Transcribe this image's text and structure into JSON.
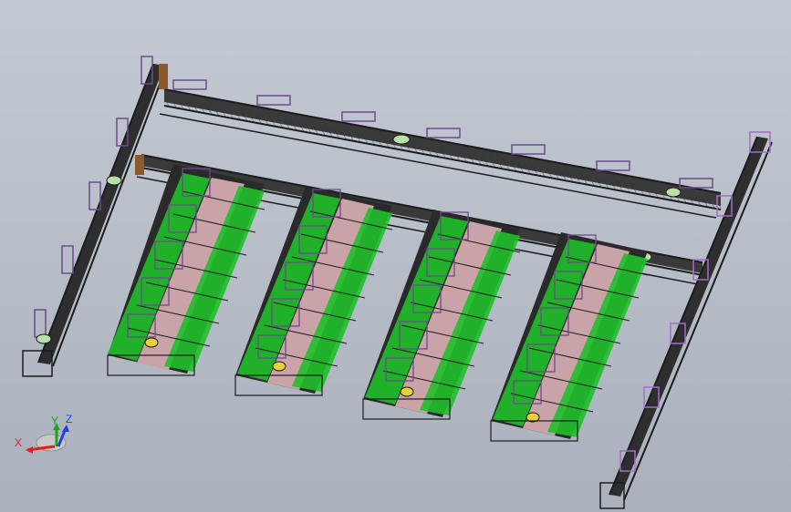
{
  "viewport": {
    "background_top": "#c4cad3",
    "background_bottom": "#aab1bc"
  },
  "colors": {
    "frame": "#1c1c1c",
    "station_green": "#1fbf2a",
    "belt_pink": "#c9a3a8",
    "fixture_purple": "#6d4b8c",
    "fixture_violet": "#a66bc9",
    "part_yellow": "#e8d23a",
    "motor_brown": "#8a5a2a",
    "pad_green": "#b8e0a8"
  },
  "triad": {
    "x_label": "X",
    "y_label": "Y",
    "z_label": "Z",
    "x_color": "#e02020",
    "y_color": "#20a020",
    "z_color": "#2040e0"
  },
  "model": {
    "description_icon": "assembly-line-icon",
    "line_count": 4
  }
}
